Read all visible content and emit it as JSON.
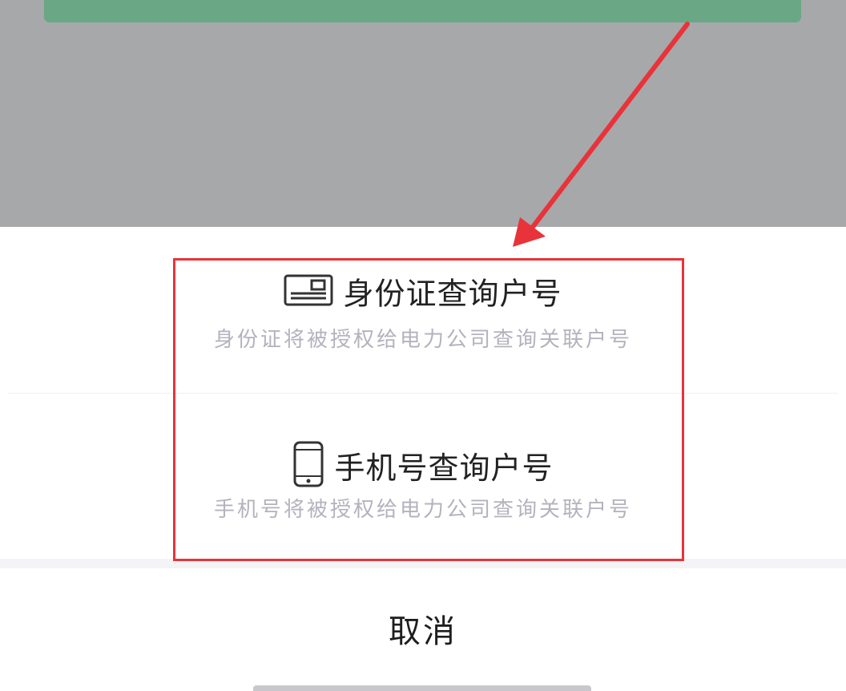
{
  "colors": {
    "overlay": "#a7a8aa",
    "green_button": "#6aa785",
    "highlight": "#e8333a",
    "subtitle_text": "#b3b3bd"
  },
  "sheet": {
    "options": [
      {
        "icon": "id-card-icon",
        "title": "身份证查询户号",
        "subtitle": "身份证将被授权给电力公司查询关联户号"
      },
      {
        "icon": "mobile-phone-icon",
        "title": "手机号查询户号",
        "subtitle": "手机号将被授权给电力公司查询关联户号"
      }
    ],
    "cancel_label": "取消"
  },
  "annotations": {
    "arrow_icon": "red-arrow-icon",
    "highlight": "red-highlight-box"
  }
}
